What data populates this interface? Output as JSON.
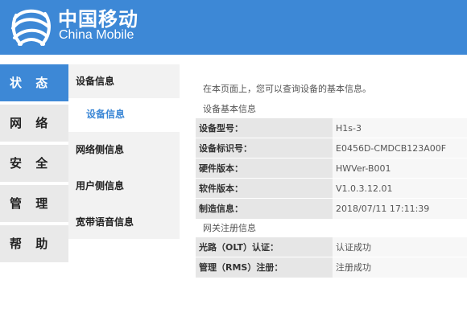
{
  "brand": {
    "name_cn": "中国移动",
    "name_en": "China Mobile",
    "logo_icon": "china-mobile-logo-icon"
  },
  "colors": {
    "accent": "#3d88d6",
    "nav_bg": "#e9e9e9",
    "label_bg": "#e6e6e6",
    "value_bg": "#f7f7f7"
  },
  "main_nav": [
    {
      "label": "状 态",
      "active": true
    },
    {
      "label": "网 络",
      "active": false
    },
    {
      "label": "安 全",
      "active": false
    },
    {
      "label": "管 理",
      "active": false
    },
    {
      "label": "帮 助",
      "active": false
    }
  ],
  "sub_nav": [
    {
      "label": "设备信息"
    },
    {
      "label": "设备信息",
      "active": true
    },
    {
      "label": "网络侧信息"
    },
    {
      "label": "用户侧信息"
    },
    {
      "label": "宽带语音信息"
    }
  ],
  "content": {
    "intro": "在本页面上，您可以查询设备的基本信息。",
    "basic_title": "设备基本信息",
    "basic_rows": [
      {
        "label": "设备型号：",
        "value": "H1s-3"
      },
      {
        "label": "设备标识号：",
        "value": "E0456D-CMDCB123A00F"
      },
      {
        "label": "硬件版本：",
        "value": "HWVer-B001"
      },
      {
        "label": "软件版本：",
        "value": "V1.0.3.12.01"
      },
      {
        "label": "制造信息：",
        "value": "2018/07/11 17:11:39"
      }
    ],
    "reg_title": "网关注册信息",
    "reg_rows": [
      {
        "label": "光路（OLT）认证：",
        "value": "认证成功"
      },
      {
        "label": "管理（RMS）注册：",
        "value": "注册成功"
      }
    ]
  }
}
